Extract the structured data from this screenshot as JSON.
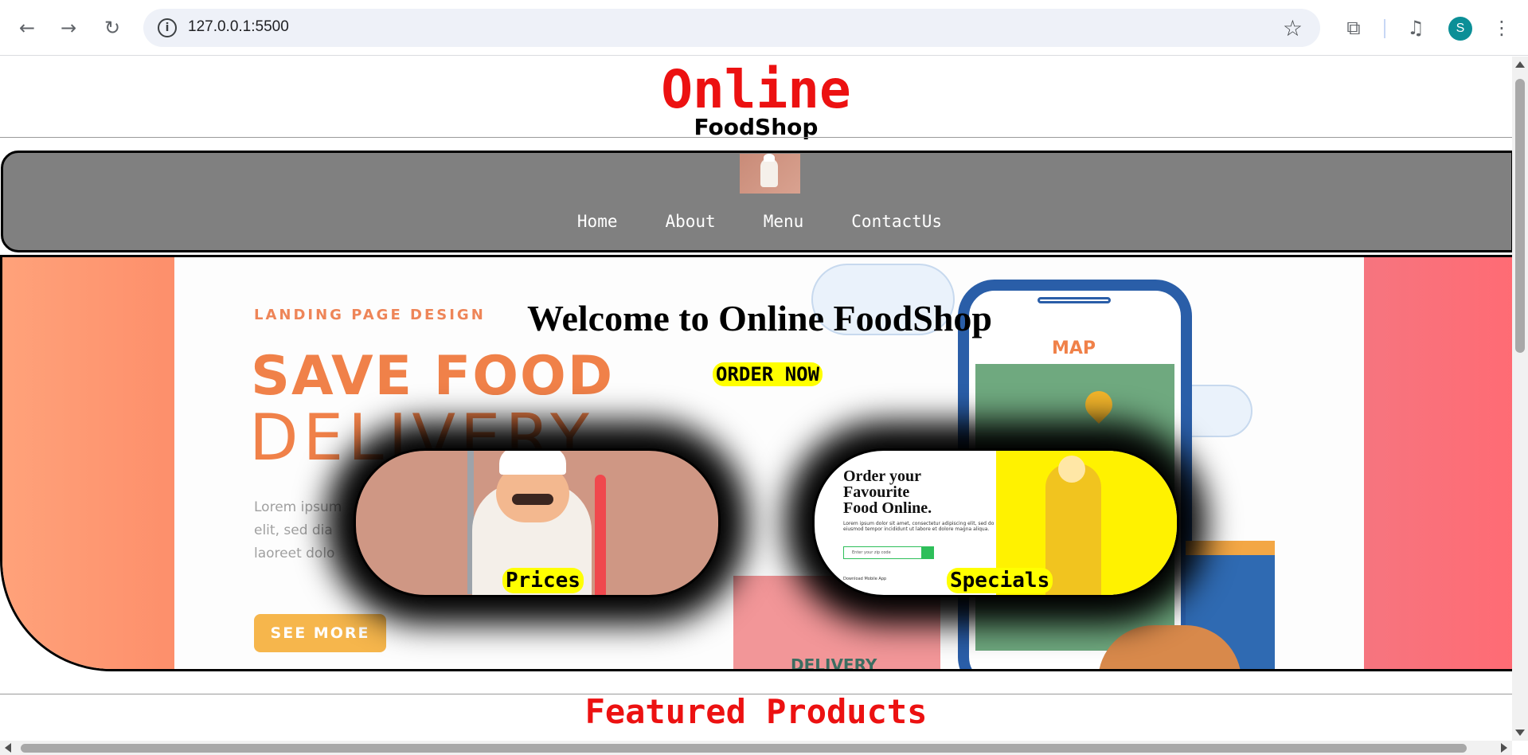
{
  "browser": {
    "url": "127.0.0.1:5500",
    "profile_initial": "S",
    "icons": [
      "back-icon",
      "forward-icon",
      "reload-icon",
      "site-info-icon",
      "bookmark-star-icon",
      "extensions-icon",
      "media-control-icon",
      "menu-kebab-icon"
    ]
  },
  "header": {
    "logo_main": "Online",
    "logo_sub": "FoodShop"
  },
  "nav": {
    "items": [
      {
        "label": "Home"
      },
      {
        "label": "About"
      },
      {
        "label": "Menu"
      },
      {
        "label": "ContactUs"
      }
    ]
  },
  "hero": {
    "welcome": "Welcome to Online FoodShop",
    "order_button": "ORDER NOW",
    "background": {
      "landing": "LANDING PAGE DESIGN",
      "save_food": "SAVE FOOD",
      "delivery": "DELIVERY",
      "lorem_lines": [
        "Lorem ipsum",
        "elit, sed dia",
        "laoreet dolo"
      ],
      "see_more": "SEE MORE",
      "map_label": "MAP",
      "box_label": "DELIVERY"
    },
    "cards": [
      {
        "label": "Prices"
      },
      {
        "label": "Specials",
        "title_lines": [
          "Order your",
          "Favourite",
          "Food Online."
        ],
        "body": "Lorem ipsum dolor sit amet, consectetur adipiscing elit, sed do eiusmod tempor incididunt ut labore et dolore magna aliqua.",
        "input_placeholder": "Enter your zip code",
        "download": "Download Mobile App"
      }
    ]
  },
  "featured": {
    "title": "Featured Products"
  },
  "colors": {
    "brand_red": "#ec1111",
    "nav_gray": "#808080",
    "highlight_yellow": "#ffff00"
  }
}
